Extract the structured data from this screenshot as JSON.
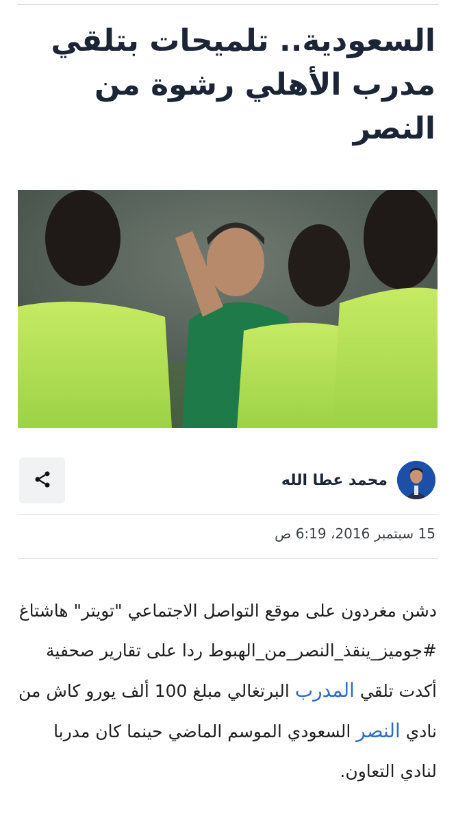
{
  "article": {
    "title": "السعودية.. تلميحات بتلقي مدرب الأهلي رشوة من النصر",
    "author": "محمد عطا الله",
    "date": "15 سبتمبر 2016، 6:19 ص",
    "body": {
      "part1": "دشن مغردون على موقع التواصل الاجتماعي \"تويتر\" هاشتاغ #جوميز_ينقذ_النصر_من_الهبوط ردا على تقارير صحفية أكدت تلقي ",
      "link1": "المدرب",
      "part2": " البرتغالي مبلغ 100 ألف يورو كاش من نادي ",
      "link2": "النصر",
      "part3": " السعودي الموسم الماضي حينما كان مدربا لنادي التعاون."
    }
  },
  "icons": {
    "share": "share-icon"
  },
  "colors": {
    "link": "#2f6bc4",
    "title": "#1c2535",
    "share_bg": "#f1f2f4"
  }
}
